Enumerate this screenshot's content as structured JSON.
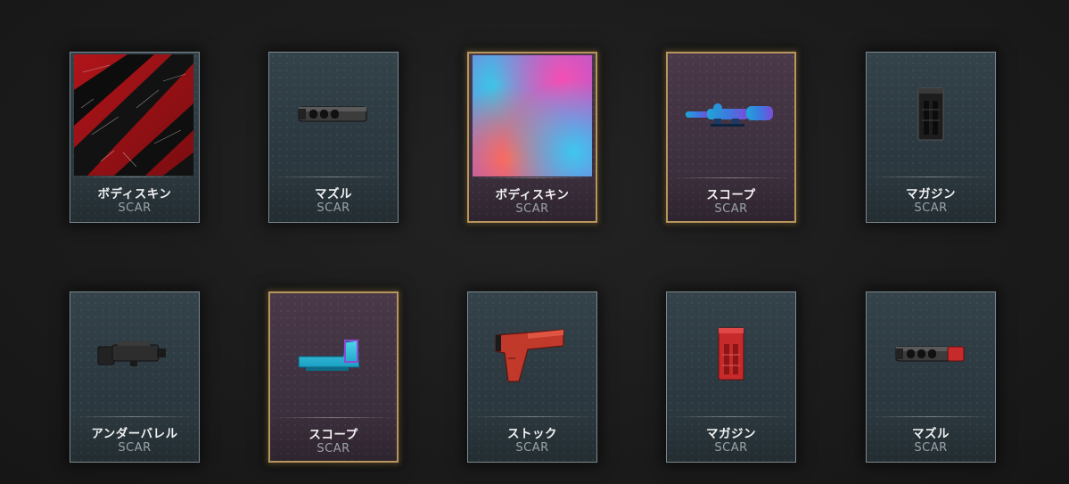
{
  "colors": {
    "background": "#1b1b1b",
    "card_common": "#2f3c43",
    "card_epic": "#41323f",
    "epic_border": "#b8955a",
    "label": "#f2f2f2",
    "sub": "#9aa3a8"
  },
  "items": [
    {
      "name": "ボディスキン",
      "weapon": "SCAR",
      "rarity": "common",
      "icon": "red-claw-skin"
    },
    {
      "name": "マズル",
      "weapon": "SCAR",
      "rarity": "common",
      "icon": "muzzle-brake-black"
    },
    {
      "name": "ボディスキン",
      "weapon": "SCAR",
      "rarity": "epic",
      "icon": "holographic-gradient-skin"
    },
    {
      "name": "スコープ",
      "weapon": "SCAR",
      "rarity": "epic",
      "icon": "rifle-scope-blue"
    },
    {
      "name": "マガジン",
      "weapon": "SCAR",
      "rarity": "common",
      "icon": "magazine-black"
    },
    {
      "name": "アンダーバレル",
      "weapon": "SCAR",
      "rarity": "common",
      "icon": "tactical-light-black"
    },
    {
      "name": "スコープ",
      "weapon": "SCAR",
      "rarity": "epic",
      "icon": "holo-sight-teal"
    },
    {
      "name": "ストック",
      "weapon": "SCAR",
      "rarity": "common",
      "icon": "stock-red"
    },
    {
      "name": "マガジン",
      "weapon": "SCAR",
      "rarity": "common",
      "icon": "magazine-red"
    },
    {
      "name": "マズル",
      "weapon": "SCAR",
      "rarity": "common",
      "icon": "muzzle-brake-red"
    }
  ]
}
